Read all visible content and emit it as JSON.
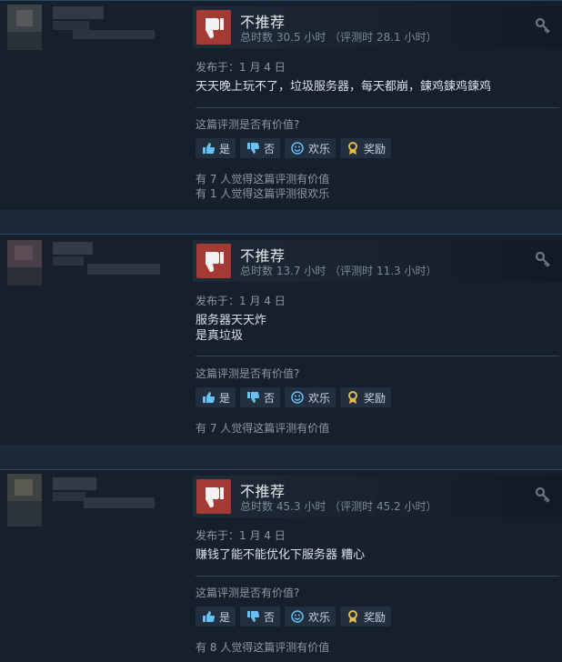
{
  "reviews": [
    {
      "recommendation": "不推荐",
      "hours": "总时数 30.5 小时   （评测时 28.1 小时）",
      "posted": "发布于：1 月 4 日",
      "content_lines": [
        "天天晚上玩不了，垃圾服务器，每天都崩，鍊鸡鍊鸡鍊鸡"
      ],
      "helpful_question": "这篇评测是否有价值?",
      "buttons": {
        "yes": "是",
        "no": "否",
        "funny": "欢乐",
        "award": "奖励"
      },
      "stats": [
        "有 7 人觉得这篇评测有价值",
        "有 1 人觉得这篇评测很欢乐"
      ]
    },
    {
      "recommendation": "不推荐",
      "hours": "总时数 13.7 小时   （评测时 11.3 小时）",
      "posted": "发布于：1 月 4 日",
      "content_lines": [
        "服务器天天炸",
        "是真垃圾"
      ],
      "helpful_question": "这篇评测是否有价值?",
      "buttons": {
        "yes": "是",
        "no": "否",
        "funny": "欢乐",
        "award": "奖励"
      },
      "stats": [
        "有 7 人觉得这篇评测有价值"
      ]
    },
    {
      "recommendation": "不推荐",
      "hours": "总时数 45.3 小时   （评测时 45.2 小时）",
      "posted": "发布于：1 月 4 日",
      "content_lines": [
        "赚钱了能不能优化下服务器 糟心"
      ],
      "helpful_question": "这篇评测是否有价值?",
      "buttons": {
        "yes": "是",
        "no": "否",
        "funny": "欢乐",
        "award": "奖励"
      },
      "stats": [
        "有 8 人觉得这篇评测有价值"
      ]
    }
  ],
  "colors": {
    "page_bg": "#1b2838",
    "review_bg": "#16202d",
    "thumb_down": "#a43a34",
    "link_blue": "#67c1f5",
    "award_gold": "#e3b94d"
  }
}
